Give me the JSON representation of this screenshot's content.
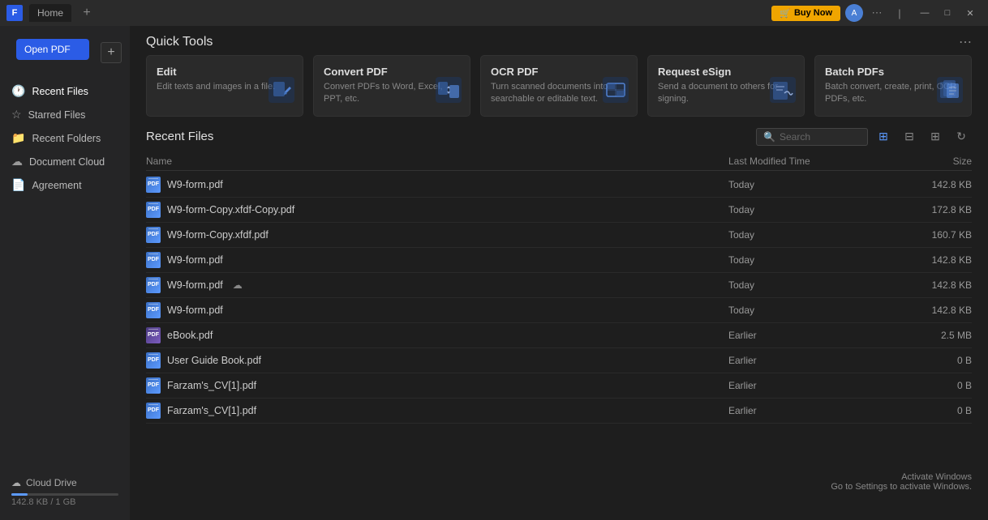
{
  "titlebar": {
    "app_icon": "F",
    "tab_label": "Home",
    "add_tab": "+",
    "buy_now_label": "Buy Now",
    "avatar_initials": "A",
    "more_icon": "⋯",
    "separator": "|",
    "minimize": "—",
    "maximize": "□",
    "close": "✕"
  },
  "sidebar": {
    "open_pdf_label": "Open PDF",
    "add_icon": "+",
    "items": [
      {
        "id": "recent-files",
        "label": "Recent Files",
        "icon": "🕐"
      },
      {
        "id": "starred-files",
        "label": "Starred Files",
        "icon": "☆"
      },
      {
        "id": "recent-folders",
        "label": "Recent Folders",
        "icon": "📁"
      },
      {
        "id": "document-cloud",
        "label": "Document Cloud",
        "icon": "☁"
      },
      {
        "id": "agreement",
        "label": "Agreement",
        "icon": "📄"
      }
    ],
    "cloud": {
      "label": "Cloud Drive",
      "icon": "☁",
      "storage_text": "142.8 KB / 1 GB",
      "progress_pct": 15
    }
  },
  "quick_tools": {
    "section_title": "Quick Tools",
    "more_icon": "⋯",
    "tools": [
      {
        "id": "edit",
        "title": "Edit",
        "desc": "Edit texts and images in a file.",
        "icon": "✏"
      },
      {
        "id": "convert-pdf",
        "title": "Convert PDF",
        "desc": "Convert PDFs to Word, Excel, PPT, etc.",
        "icon": "⇄"
      },
      {
        "id": "ocr-pdf",
        "title": "OCR PDF",
        "desc": "Turn scanned documents into searchable or editable text.",
        "icon": "⊞"
      },
      {
        "id": "request-esign",
        "title": "Request eSign",
        "desc": "Send a document to others for signing.",
        "icon": "✍"
      },
      {
        "id": "batch-pdfs",
        "title": "Batch PDFs",
        "desc": "Batch convert, create, print, OCR PDFs, etc.",
        "icon": "☰"
      }
    ]
  },
  "recent_files": {
    "section_title": "Recent Files",
    "search_placeholder": "Search",
    "columns": {
      "name": "Name",
      "modified": "Last Modified Time",
      "size": "Size"
    },
    "view_icons": [
      "grid-large",
      "grid-small",
      "columns",
      "refresh"
    ],
    "files": [
      {
        "name": "W9-form.pdf",
        "modified": "Today",
        "size": "142.8 KB",
        "cloud": false
      },
      {
        "name": "W9-form-Copy.xfdf-Copy.pdf",
        "modified": "Today",
        "size": "172.8 KB",
        "cloud": false
      },
      {
        "name": "W9-form-Copy.xfdf.pdf",
        "modified": "Today",
        "size": "160.7 KB",
        "cloud": false
      },
      {
        "name": "W9-form.pdf",
        "modified": "Today",
        "size": "142.8 KB",
        "cloud": false
      },
      {
        "name": "W9-form.pdf",
        "modified": "Today",
        "size": "142.8 KB",
        "cloud": true
      },
      {
        "name": "W9-form.pdf",
        "modified": "Today",
        "size": "142.8 KB",
        "cloud": false
      },
      {
        "name": "eBook.pdf",
        "modified": "Earlier",
        "size": "2.5 MB",
        "cloud": false
      },
      {
        "name": "User Guide Book.pdf",
        "modified": "Earlier",
        "size": "0 B",
        "cloud": false
      },
      {
        "name": "Farzam's_CV[1].pdf",
        "modified": "Earlier",
        "size": "0 B",
        "cloud": false
      },
      {
        "name": "Farzam's_CV[1].pdf",
        "modified": "Earlier",
        "size": "0 B",
        "cloud": false
      }
    ]
  },
  "windows_activate": {
    "line1": "Activate Windows",
    "line2": "Go to Settings to activate Windows."
  }
}
